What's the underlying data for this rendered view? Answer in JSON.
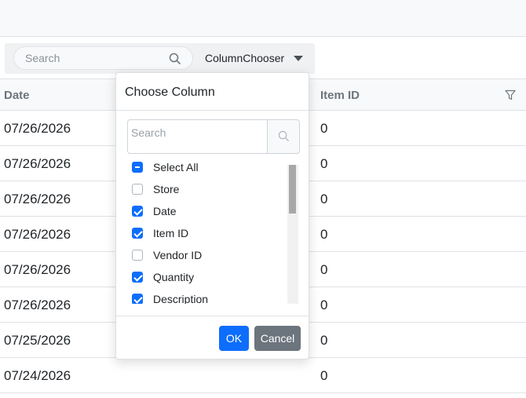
{
  "toolbar": {
    "search_placeholder": "Search",
    "column_chooser_label": "ColumnChooser"
  },
  "grid": {
    "columns": [
      "Date",
      "Item ID"
    ],
    "rows": [
      {
        "date": "07/26/2026",
        "item_id": "0"
      },
      {
        "date": "07/26/2026",
        "item_id": "0"
      },
      {
        "date": "07/26/2026",
        "item_id": "0"
      },
      {
        "date": "07/26/2026",
        "item_id": "0"
      },
      {
        "date": "07/26/2026",
        "item_id": "0"
      },
      {
        "date": "07/26/2026",
        "item_id": "0"
      },
      {
        "date": "07/25/2026",
        "item_id": "0"
      },
      {
        "date": "07/24/2026",
        "item_id": "0"
      }
    ]
  },
  "dialog": {
    "title": "Choose Column",
    "search_placeholder": "Search",
    "options": [
      {
        "label": "Select All",
        "state": "indeterminate"
      },
      {
        "label": "Store",
        "state": "unchecked"
      },
      {
        "label": "Date",
        "state": "checked"
      },
      {
        "label": "Item ID",
        "state": "checked"
      },
      {
        "label": "Vendor ID",
        "state": "unchecked"
      },
      {
        "label": "Quantity",
        "state": "checked"
      },
      {
        "label": "Description",
        "state": "checked"
      }
    ],
    "ok_label": "OK",
    "cancel_label": "Cancel"
  },
  "colors": {
    "primary": "#0d6efd",
    "secondary": "#6c757d",
    "header_text": "#6c757d",
    "border": "#dee2e6"
  }
}
